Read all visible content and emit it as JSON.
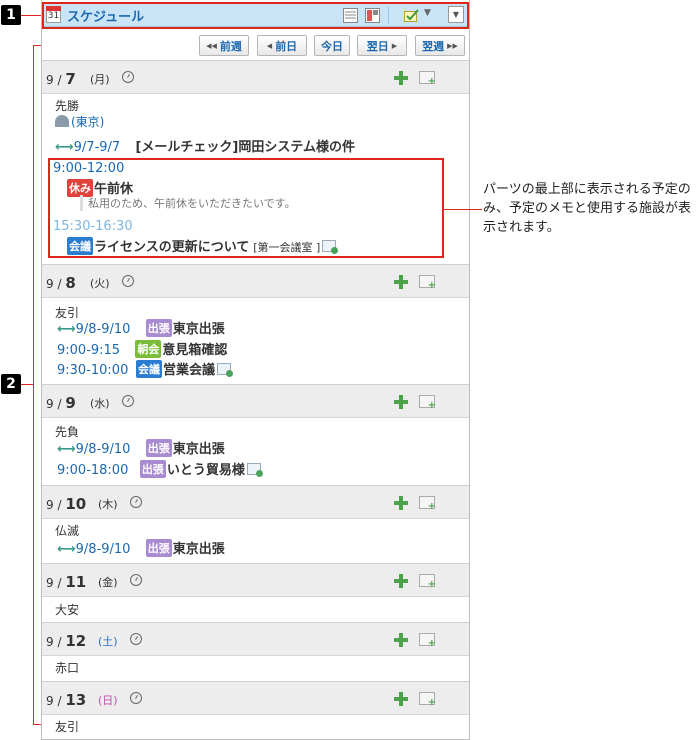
{
  "callouts": {
    "one": "1",
    "two": "2"
  },
  "header": {
    "title": "スケジュール",
    "calendar_day": "31"
  },
  "nav": {
    "prev_week": "前週",
    "prev_day": "前日",
    "today": "今日",
    "next_day": "翌日",
    "next_week": "翌週"
  },
  "note": "パーツの最上部に表示される予定のみ、予定のメモと使用する施設が表示されます。",
  "days": [
    {
      "month": "9 /",
      "day": "7",
      "dow": "(月)",
      "rokuyo": "先勝",
      "weather_location": "(東京)",
      "range": "9/7-9/7",
      "range_title": "[メールチェック]岡田システム様の件",
      "events": [
        {
          "time": "9:00-12:00",
          "badge": "休み",
          "title": "午前休",
          "memo": "私用のため、午前休をいただきたいです。"
        },
        {
          "time": "15:30-16:30",
          "badge": "会議",
          "title": "ライセンスの更新について",
          "facility": "[第一会議室 ]"
        }
      ]
    },
    {
      "month": "9 /",
      "day": "8",
      "dow": "(火)",
      "rokuyo": "友引",
      "events": [
        {
          "time": "9/8-9/10",
          "badge": "出張",
          "title": "東京出張"
        },
        {
          "time": "9:00-9:15",
          "badge": "朝会",
          "title": "意見箱確認"
        },
        {
          "time": "9:30-10:00",
          "badge": "会議",
          "title": "営業会議"
        }
      ]
    },
    {
      "month": "9 /",
      "day": "9",
      "dow": "(水)",
      "rokuyo": "先負",
      "events": [
        {
          "time": "9/8-9/10",
          "badge": "出張",
          "title": "東京出張"
        },
        {
          "time": "9:00-18:00",
          "badge": "出張",
          "title": "いとう貿易様"
        }
      ]
    },
    {
      "month": "9 /",
      "day": "10",
      "dow": "(木)",
      "rokuyo": "仏滅",
      "events": [
        {
          "time": "9/8-9/10",
          "badge": "出張",
          "title": "東京出張"
        }
      ]
    },
    {
      "month": "9 /",
      "day": "11",
      "dow": "(金)",
      "rokuyo": "大安"
    },
    {
      "month": "9 /",
      "day": "12",
      "dow": "(土)",
      "rokuyo": "赤口"
    },
    {
      "month": "9 /",
      "day": "13",
      "dow": "(日)",
      "rokuyo": "友引"
    }
  ]
}
